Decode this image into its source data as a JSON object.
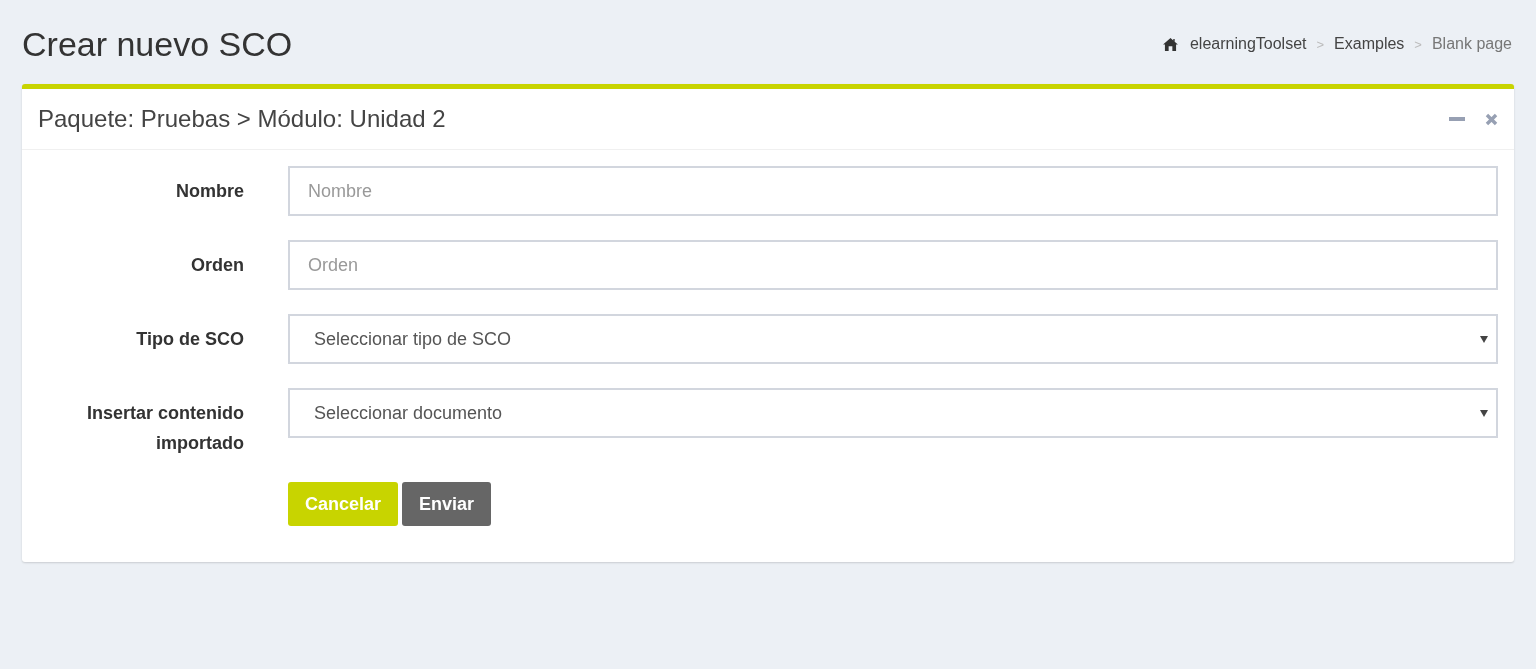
{
  "page_title": "Crear nuevo SCO",
  "breadcrumb": {
    "separator": ">",
    "items": [
      {
        "label": "elearningToolset",
        "current": false
      },
      {
        "label": "Examples",
        "current": false
      },
      {
        "label": "Blank page",
        "current": true
      }
    ]
  },
  "box": {
    "title": "Paquete: Pruebas > Módulo: Unidad 2",
    "fields": [
      {
        "kind": "text",
        "label": "Nombre",
        "placeholder": "Nombre"
      },
      {
        "kind": "text",
        "label": "Orden",
        "placeholder": "Orden"
      },
      {
        "kind": "select",
        "label": "Tipo de SCO",
        "value": "Seleccionar tipo de SCO"
      },
      {
        "kind": "select",
        "label": "Insertar contenido importado",
        "value": "Seleccionar documento"
      }
    ],
    "buttons": [
      {
        "kind": "primary",
        "label": "Cancelar"
      },
      {
        "kind": "secondary",
        "label": "Enviar"
      }
    ]
  }
}
